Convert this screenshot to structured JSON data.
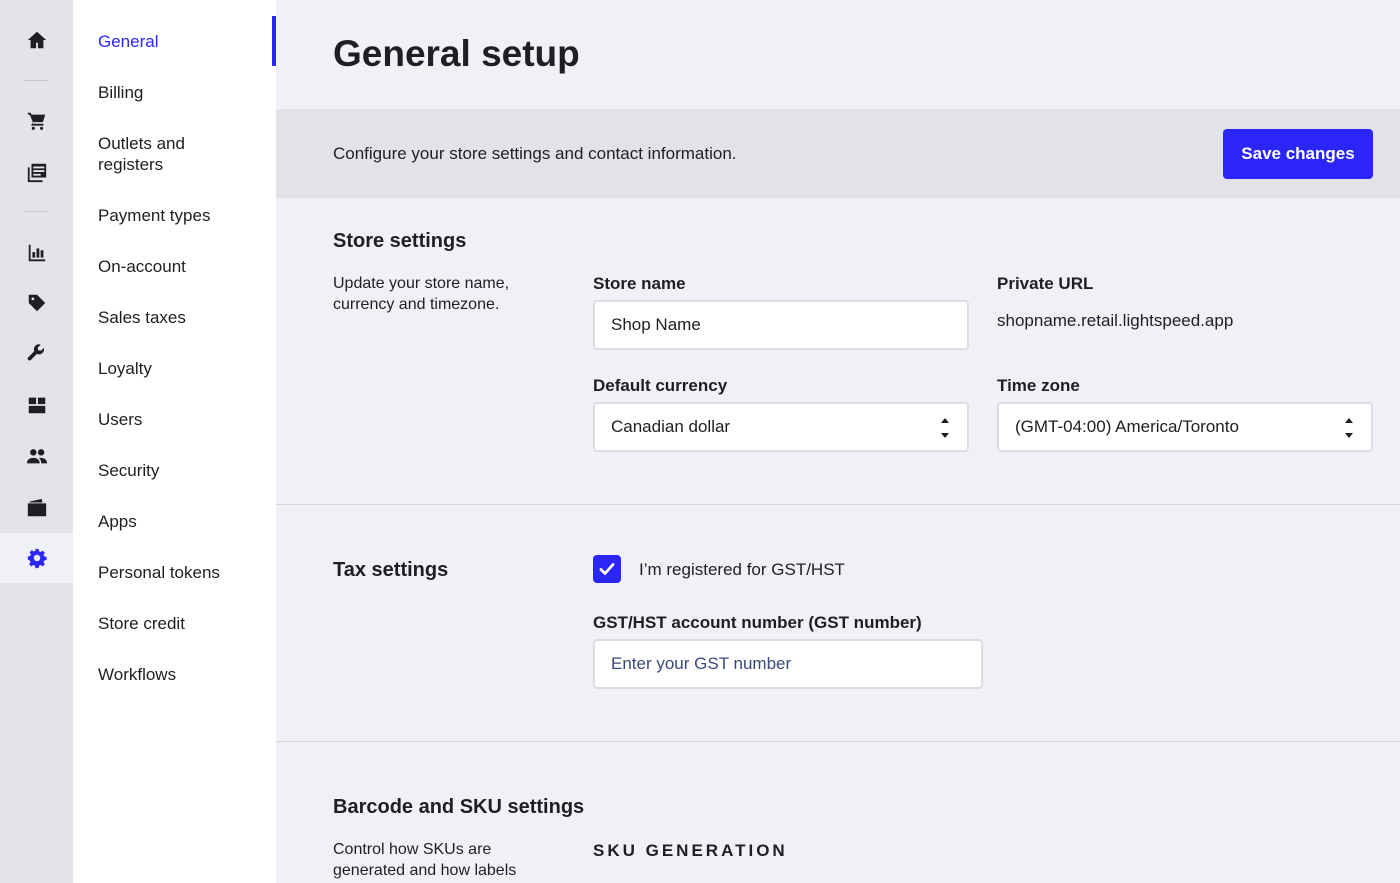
{
  "rail": {
    "items": [
      {
        "name": "home-icon"
      },
      {
        "name": "cart-icon"
      },
      {
        "name": "catalog-icon"
      },
      {
        "name": "reports-icon"
      },
      {
        "name": "tag-icon"
      },
      {
        "name": "wrench-icon"
      },
      {
        "name": "inventory-icon"
      },
      {
        "name": "customers-icon"
      },
      {
        "name": "wallet-icon"
      },
      {
        "name": "settings-icon",
        "active": true
      }
    ],
    "accent": "#2b25f7"
  },
  "nav": {
    "items": [
      {
        "label": "General",
        "active": true
      },
      {
        "label": "Billing"
      },
      {
        "label": "Outlets and registers"
      },
      {
        "label": "Payment types"
      },
      {
        "label": "On-account"
      },
      {
        "label": "Sales taxes"
      },
      {
        "label": "Loyalty"
      },
      {
        "label": "Users"
      },
      {
        "label": "Security"
      },
      {
        "label": "Apps"
      },
      {
        "label": "Personal tokens"
      },
      {
        "label": "Store credit"
      },
      {
        "label": "Workflows"
      }
    ]
  },
  "page": {
    "title": "General setup",
    "banner_text": "Configure your store settings and contact information.",
    "save_label": "Save changes"
  },
  "store_settings": {
    "title": "Store settings",
    "description": "Update your store name, currency and timezone.",
    "store_name_label": "Store name",
    "store_name_value": "Shop Name",
    "private_url_label": "Private URL",
    "private_url_value": "shopname.retail.lightspeed.app",
    "currency_label": "Default currency",
    "currency_value": "Canadian dollar",
    "timezone_label": "Time zone",
    "timezone_value": "(GMT-04:00) America/Toronto"
  },
  "tax_settings": {
    "title": "Tax settings",
    "gst_checkbox_label": "I’m registered for GST/HST",
    "gst_checked": true,
    "gst_number_label": "GST/HST account number (GST number)",
    "gst_number_placeholder": "Enter your GST number"
  },
  "barcode_settings": {
    "title": "Barcode and SKU settings",
    "description": "Control how SKUs are generated and how labels",
    "sku_generation_heading": "SKU GENERATION"
  }
}
